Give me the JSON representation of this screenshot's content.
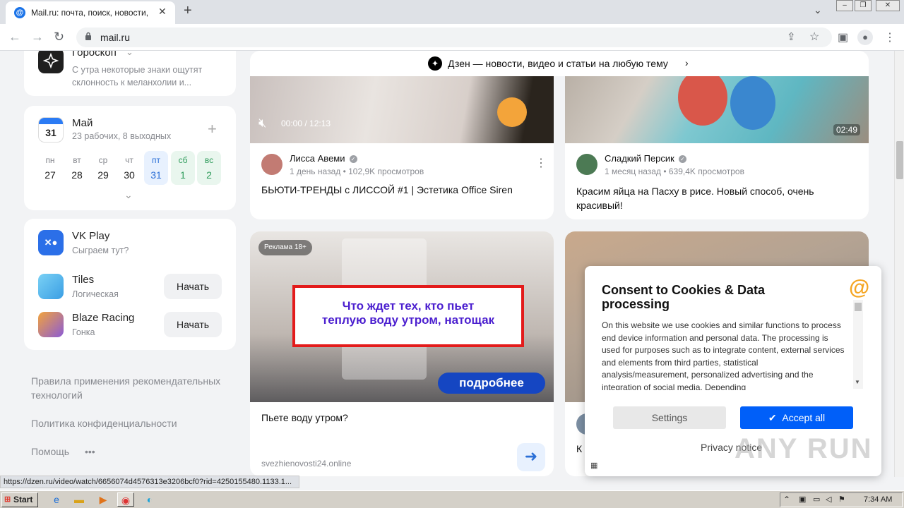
{
  "browser": {
    "tab_title": "Mail.ru: почта, поиск, новости, прогноз",
    "tab_favicon": "@",
    "new_tab": "+",
    "url": "mail.ru",
    "status_url": "https://dzen.ru/video/watch/6656074d4576313e3206bcf0?rid=4250155480.1133.1..."
  },
  "sidebar": {
    "horoscope": {
      "title": "Гороскоп",
      "text": "С утра некоторые знаки ощутят склонность к меланхолии и..."
    },
    "calendar": {
      "icon_day": "31",
      "month": "Май",
      "summary": "23 рабочих, 8 выходных",
      "add": "+",
      "days": [
        {
          "w": "пн",
          "n": "27"
        },
        {
          "w": "вт",
          "n": "28"
        },
        {
          "w": "ср",
          "n": "29"
        },
        {
          "w": "чт",
          "n": "30"
        },
        {
          "w": "пт",
          "n": "31"
        },
        {
          "w": "сб",
          "n": "1"
        },
        {
          "w": "вс",
          "n": "2"
        }
      ]
    },
    "vkplay": {
      "title": "VK Play",
      "subtitle": "Сыграем тут?",
      "games": [
        {
          "name": "Tiles",
          "genre": "Логическая",
          "button": "Начать"
        },
        {
          "name": "Blaze Racing",
          "genre": "Гонка",
          "button": "Начать"
        }
      ]
    },
    "footer": {
      "rules": "Правила применения рекомендательных технологий",
      "privacy": "Политика конфиденциальности",
      "help": "Помощь",
      "more": "•••"
    }
  },
  "feed": {
    "dzen_header": "Дзен — новости, видео и статьи на любую тему",
    "video1": {
      "time": "00:00 / 12:13",
      "author": "Лисса Авеми",
      "meta": "1 день назад • 102,9K просмотров",
      "title": "БЬЮТИ-ТРЕНДЫ с ЛИССОЙ #1 | Эстетика Office Siren"
    },
    "video2": {
      "duration": "02:49",
      "author": "Сладкий Персик",
      "meta": "1 месяц назад • 639,4K просмотров",
      "title": "Красим яйца на Пасху в рисе. Новый способ, очень красивый!"
    },
    "ad": {
      "badge": "Реклама 18+",
      "banner_line1": "Что ждет тех, кто пьет",
      "banner_line2": "теплую воду утром, натощак",
      "banner_button": "подробнее",
      "title": "Пьете воду утром?",
      "domain": "svezhienovosti24.online"
    },
    "card4_initial": "К"
  },
  "cookie": {
    "title": "Consent to Cookies & Data processing",
    "body": "On this website we use cookies and similar functions to process end device information and personal data. The processing is used for purposes such as to integrate content, external services and elements from third parties, statistical analysis/measurement, personalized advertising and the integration of social media. Depending",
    "settings": "Settings",
    "accept": "Accept all",
    "privacy": "Privacy notice",
    "logo": "@"
  },
  "taskbar": {
    "start": "Start",
    "time": "7:34 AM"
  },
  "watermark": "ANY RUN"
}
